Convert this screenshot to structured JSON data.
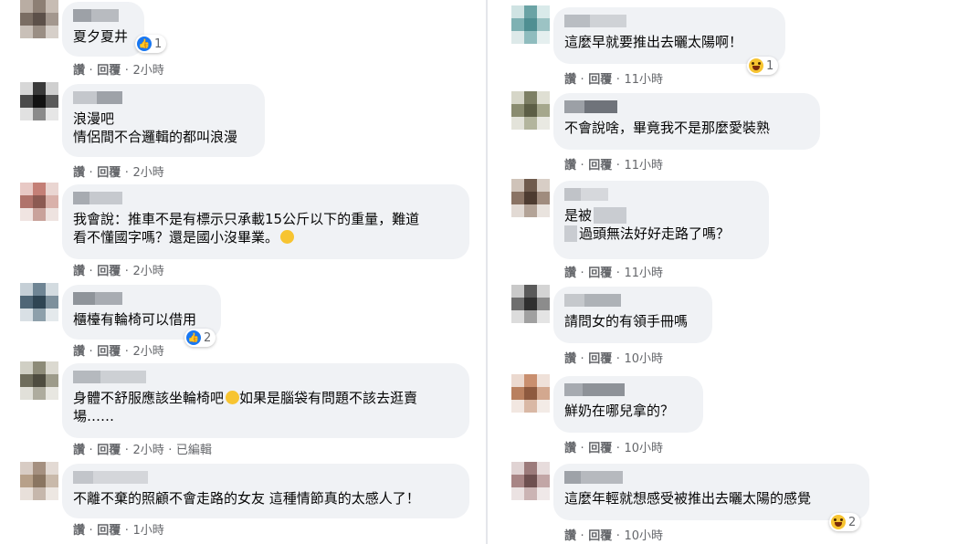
{
  "actions": {
    "like": "讚",
    "reply": "回覆",
    "sep": "·",
    "edited": "已編輯"
  },
  "left": [
    {
      "text": "夏夕夏井",
      "time": "2小時",
      "react": {
        "type": "like",
        "count": "1"
      }
    },
    {
      "text": "浪漫吧\n情侶間不合邏輯的都叫浪漫",
      "time": "2小時"
    },
    {
      "text": "我會說：推車不是有標示只承載15公斤以下的重量，難道\n看不懂國字嗎？還是國小沒畢業。",
      "time": "2小時",
      "emoji": "thinking-face"
    },
    {
      "text": "櫃檯有輪椅可以借用",
      "time": "2小時",
      "react": {
        "type": "like",
        "count": "2"
      }
    },
    {
      "text_a": "身體不舒服應該坐輪椅吧",
      "text_b": "如果是腦袋有問題不該去逛賣\n場……",
      "time": "2小時",
      "edited": true,
      "emoji": "thinking-face"
    },
    {
      "text": "不離不棄的照顧不會走路的女友 這種情節真的太感人了！",
      "time": "1小時"
    }
  ],
  "right": [
    {
      "text": "這麼早就要推出去曬太陽啊！",
      "time": "11小時",
      "react": {
        "type": "haha",
        "count": "1"
      }
    },
    {
      "text": "不會說啥，畢竟我不是那麼愛裝熟",
      "time": "11小時"
    },
    {
      "text_a": "是被",
      "text_b": "過頭無法好好走路了嗎？",
      "time": "11小時"
    },
    {
      "text": "請問女的有領手冊嗎",
      "time": "10小時"
    },
    {
      "text": "鮮奶在哪兒拿的？",
      "time": "10小時"
    },
    {
      "text": "這麼年輕就想感受被推出去曬太陽的感覺",
      "time": "10小時",
      "react": {
        "type": "haha",
        "count": "2"
      }
    }
  ],
  "colors": {
    "bubble": "#f0f2f5",
    "meta": "#65676b",
    "text": "#050505",
    "like": "#1877f2",
    "haha": "#f7c431"
  }
}
